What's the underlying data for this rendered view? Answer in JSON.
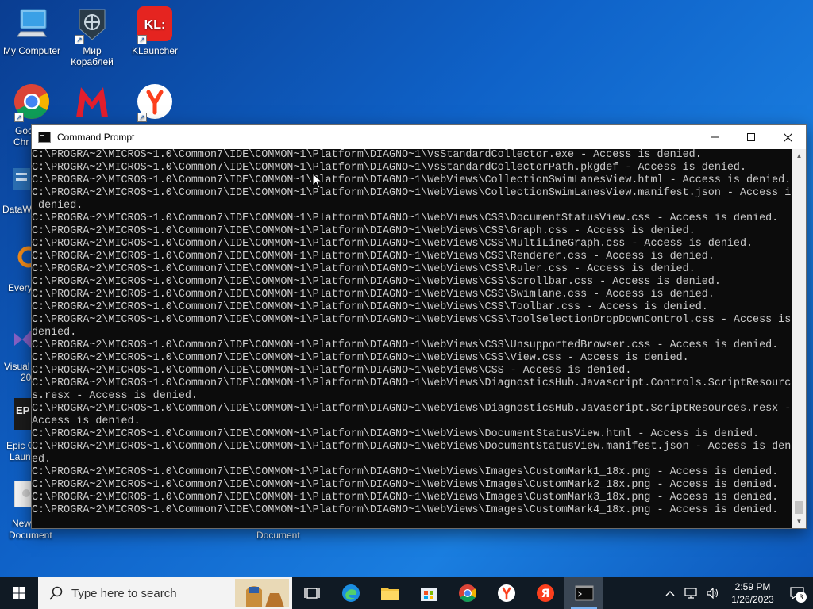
{
  "desktop": {
    "icons": [
      {
        "label": "My Computer"
      },
      {
        "label": "Мир Кораблей"
      },
      {
        "label": "KLauncher"
      },
      {
        "label": "Google Chrome"
      },
      {
        "label": "DataW"
      },
      {
        "label": "Every"
      },
      {
        "label": "Visual 20"
      },
      {
        "label": "Epic G Launc"
      },
      {
        "label": "New Document"
      },
      {
        "label": "Document"
      }
    ],
    "partial": {
      "chrome_line1": "Goo",
      "chrome_line2": "Chr",
      "dataw": "DataW",
      "every": "Every",
      "visual_line1": "Visual",
      "visual_line2": "20",
      "epic_line1": "Epic G",
      "epic_line2": "Laun",
      "newdoc_line1": "New",
      "newdoc_line2": "Document",
      "document": "Document"
    }
  },
  "window": {
    "title": "Command Prompt",
    "lines": [
      "C:\\PROGRA~2\\MICROS~1.0\\Common7\\IDE\\COMMON~1\\Platform\\DIAGNO~1\\VsStandardCollector.exe - Access is denied.",
      "C:\\PROGRA~2\\MICROS~1.0\\Common7\\IDE\\COMMON~1\\Platform\\DIAGNO~1\\VsStandardCollectorPath.pkgdef - Access is denied.",
      "C:\\PROGRA~2\\MICROS~1.0\\Common7\\IDE\\COMMON~1\\Platform\\DIAGNO~1\\WebViews\\CollectionSwimLanesView.html - Access is denied.",
      "C:\\PROGRA~2\\MICROS~1.0\\Common7\\IDE\\COMMON~1\\Platform\\DIAGNO~1\\WebViews\\CollectionSwimLanesView.manifest.json - Access is",
      " denied.",
      "C:\\PROGRA~2\\MICROS~1.0\\Common7\\IDE\\COMMON~1\\Platform\\DIAGNO~1\\WebViews\\CSS\\DocumentStatusView.css - Access is denied.",
      "C:\\PROGRA~2\\MICROS~1.0\\Common7\\IDE\\COMMON~1\\Platform\\DIAGNO~1\\WebViews\\CSS\\Graph.css - Access is denied.",
      "C:\\PROGRA~2\\MICROS~1.0\\Common7\\IDE\\COMMON~1\\Platform\\DIAGNO~1\\WebViews\\CSS\\MultiLineGraph.css - Access is denied.",
      "C:\\PROGRA~2\\MICROS~1.0\\Common7\\IDE\\COMMON~1\\Platform\\DIAGNO~1\\WebViews\\CSS\\Renderer.css - Access is denied.",
      "C:\\PROGRA~2\\MICROS~1.0\\Common7\\IDE\\COMMON~1\\Platform\\DIAGNO~1\\WebViews\\CSS\\Ruler.css - Access is denied.",
      "C:\\PROGRA~2\\MICROS~1.0\\Common7\\IDE\\COMMON~1\\Platform\\DIAGNO~1\\WebViews\\CSS\\Scrollbar.css - Access is denied.",
      "C:\\PROGRA~2\\MICROS~1.0\\Common7\\IDE\\COMMON~1\\Platform\\DIAGNO~1\\WebViews\\CSS\\Swimlane.css - Access is denied.",
      "C:\\PROGRA~2\\MICROS~1.0\\Common7\\IDE\\COMMON~1\\Platform\\DIAGNO~1\\WebViews\\CSS\\Toolbar.css - Access is denied.",
      "C:\\PROGRA~2\\MICROS~1.0\\Common7\\IDE\\COMMON~1\\Platform\\DIAGNO~1\\WebViews\\CSS\\ToolSelectionDropDownControl.css - Access is",
      "denied.",
      "C:\\PROGRA~2\\MICROS~1.0\\Common7\\IDE\\COMMON~1\\Platform\\DIAGNO~1\\WebViews\\CSS\\UnsupportedBrowser.css - Access is denied.",
      "C:\\PROGRA~2\\MICROS~1.0\\Common7\\IDE\\COMMON~1\\Platform\\DIAGNO~1\\WebViews\\CSS\\View.css - Access is denied.",
      "C:\\PROGRA~2\\MICROS~1.0\\Common7\\IDE\\COMMON~1\\Platform\\DIAGNO~1\\WebViews\\CSS - Access is denied.",
      "C:\\PROGRA~2\\MICROS~1.0\\Common7\\IDE\\COMMON~1\\Platform\\DIAGNO~1\\WebViews\\DiagnosticsHub.Javascript.Controls.ScriptResource",
      "s.resx - Access is denied.",
      "C:\\PROGRA~2\\MICROS~1.0\\Common7\\IDE\\COMMON~1\\Platform\\DIAGNO~1\\WebViews\\DiagnosticsHub.Javascript.ScriptResources.resx -",
      "Access is denied.",
      "C:\\PROGRA~2\\MICROS~1.0\\Common7\\IDE\\COMMON~1\\Platform\\DIAGNO~1\\WebViews\\DocumentStatusView.html - Access is denied.",
      "C:\\PROGRA~2\\MICROS~1.0\\Common7\\IDE\\COMMON~1\\Platform\\DIAGNO~1\\WebViews\\DocumentStatusView.manifest.json - Access is deni",
      "ed.",
      "C:\\PROGRA~2\\MICROS~1.0\\Common7\\IDE\\COMMON~1\\Platform\\DIAGNO~1\\WebViews\\Images\\CustomMark1_18x.png - Access is denied.",
      "C:\\PROGRA~2\\MICROS~1.0\\Common7\\IDE\\COMMON~1\\Platform\\DIAGNO~1\\WebViews\\Images\\CustomMark2_18x.png - Access is denied.",
      "C:\\PROGRA~2\\MICROS~1.0\\Common7\\IDE\\COMMON~1\\Platform\\DIAGNO~1\\WebViews\\Images\\CustomMark3_18x.png - Access is denied.",
      "C:\\PROGRA~2\\MICROS~1.0\\Common7\\IDE\\COMMON~1\\Platform\\DIAGNO~1\\WebViews\\Images\\CustomMark4_18x.png - Access is denied."
    ]
  },
  "taskbar": {
    "search_placeholder": "Type here to search",
    "time": "2:59 PM",
    "date": "1/26/2023",
    "notification_count": "3"
  },
  "colors": {
    "console_bg": "#0c0c0c",
    "console_text": "#cccccc",
    "taskbar_bg": "#101a24"
  }
}
